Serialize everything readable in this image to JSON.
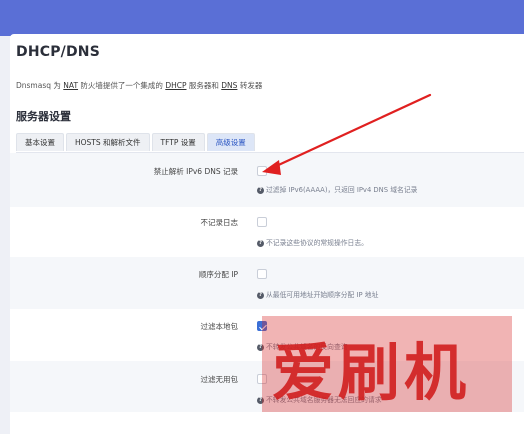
{
  "page": {
    "title": "DHCP/DNS",
    "description": [
      "Dnsmasq 为 ",
      "NAT",
      " 防火墙提供了一个集成的 ",
      "DHCP",
      " 服务器和 ",
      "DNS",
      " 转发器"
    ],
    "section_title": "服务器设置"
  },
  "tabs": [
    {
      "label": "基本设置",
      "active": false
    },
    {
      "label": "HOSTS 和解析文件",
      "active": false
    },
    {
      "label": "TFTP 设置",
      "active": false
    },
    {
      "label": "高级设置",
      "active": true
    }
  ],
  "options": [
    {
      "label": "禁止解析 IPv6 DNS 记录",
      "checked": false,
      "help": "过滤掉 IPv6(AAAA)，只返回 IPv4 DNS 域名记录"
    },
    {
      "label": "不记录日志",
      "checked": false,
      "help": "不记录这些协议的常规操作日志。"
    },
    {
      "label": "顺序分配 IP",
      "checked": false,
      "help": "从最低可用地址开始顺序分配 IP 地址"
    },
    {
      "label": "过滤本地包",
      "checked": true,
      "help": "不转发公共域名的反向查询"
    },
    {
      "label": "过滤无用包",
      "checked": false,
      "help": "不转发公共域名服务器无法回应的请求"
    }
  ],
  "watermark": "爱刷机",
  "colors": {
    "accent": "#3b6fd6",
    "topbar": "#5a6fd6",
    "arrow": "#e02020"
  }
}
